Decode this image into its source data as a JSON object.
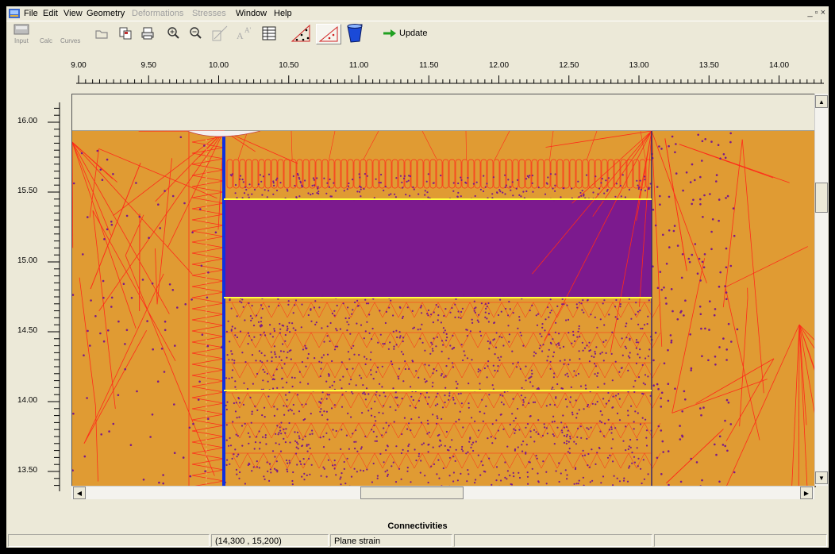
{
  "menu": {
    "items": [
      {
        "label": "File",
        "disabled": false
      },
      {
        "label": "Edit",
        "disabled": false
      },
      {
        "label": "View",
        "disabled": false
      },
      {
        "label": "Geometry",
        "disabled": false
      },
      {
        "label": "Deformations",
        "disabled": true
      },
      {
        "label": "Stresses",
        "disabled": true
      },
      {
        "label": "Window",
        "disabled": false
      },
      {
        "label": "Help",
        "disabled": false
      }
    ],
    "window_controls": "_ ▫ ×"
  },
  "toolbar": {
    "input_label": "Input",
    "calc_label": "Calc",
    "curves_label": "Curves",
    "update_label": "Update"
  },
  "rulers": {
    "x_ticks": [
      "9.00",
      "9.50",
      "10.00",
      "10.50",
      "11.00",
      "11.50",
      "12.00",
      "12.50",
      "13.00",
      "13.50",
      "14.00"
    ],
    "y_ticks": [
      "16.00",
      "15.50",
      "15.00",
      "14.50",
      "14.00",
      "13.50"
    ]
  },
  "colors": {
    "soil": "#e09b33",
    "mesh": "#ff2a1a",
    "nodes": "#7a1a8a",
    "plate": "#1030e0",
    "interface": "#ffff40"
  },
  "caption": "Connectivities",
  "status": {
    "coords": "(14,300 , 15,200)",
    "mode": "Plane strain"
  }
}
